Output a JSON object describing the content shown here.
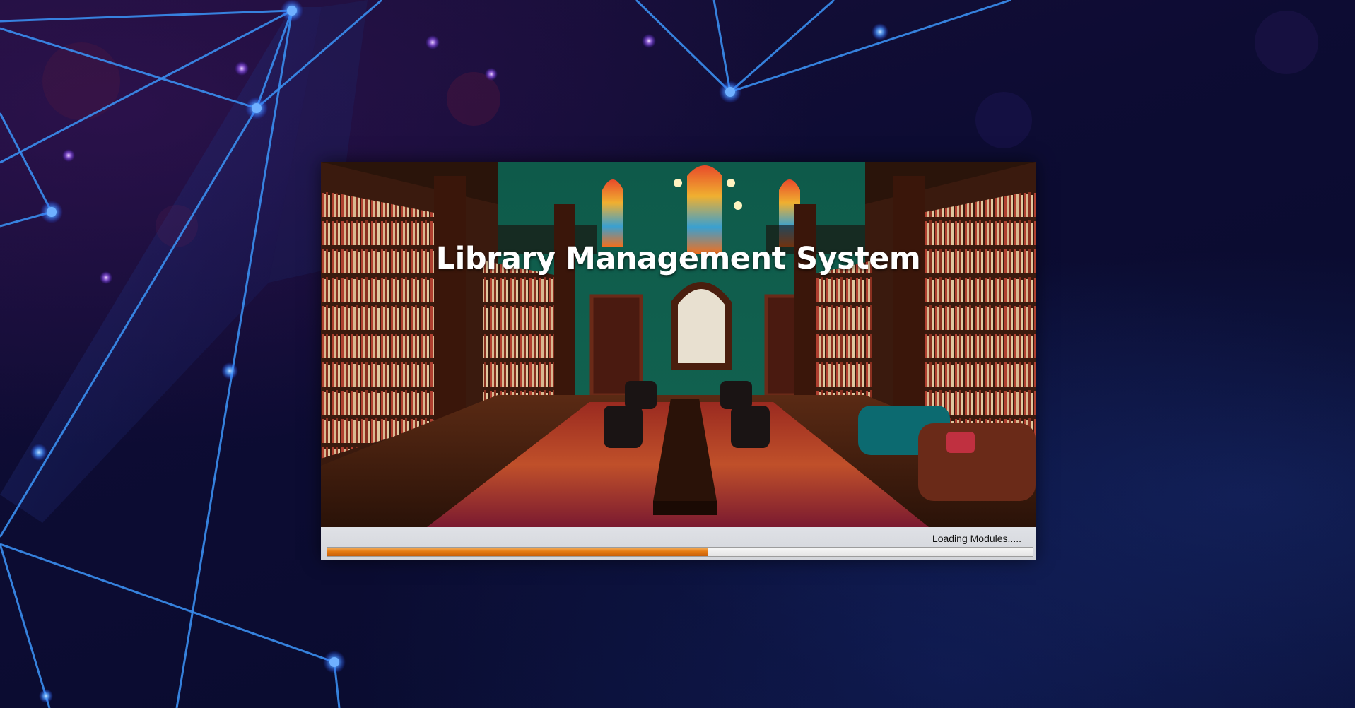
{
  "splash": {
    "title": "Library Management System",
    "status_text": "Loading Modules.....",
    "progress_fraction": 0.54,
    "progress_color": "#e57b12"
  },
  "colors": {
    "desktop_background": "#0b0b2e",
    "network_line": "#3a8ef0",
    "library_wall": "#11614f"
  }
}
